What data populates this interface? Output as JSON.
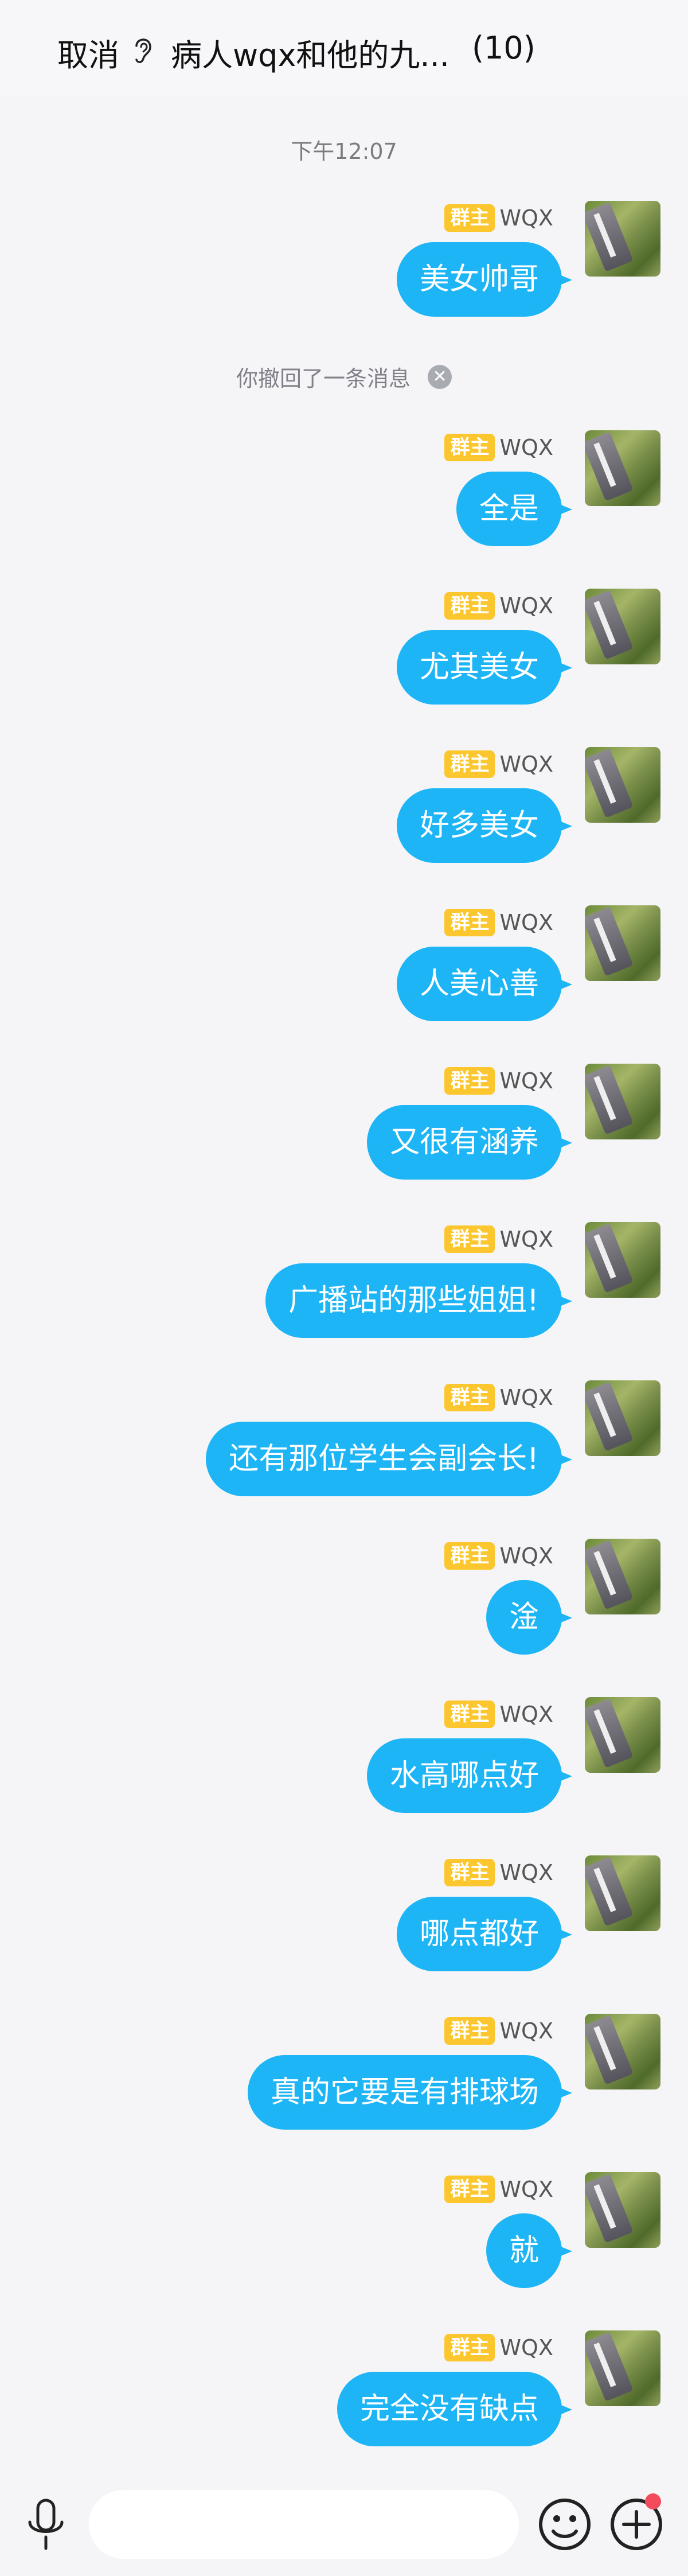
{
  "header": {
    "cancel_label": "取消",
    "group_title": "病人wqx和他的九...",
    "member_count": "(10)",
    "icon": "ear-icon"
  },
  "timestamp": "下午12:07",
  "recall_notice": "你撤回了一条消息",
  "sender": {
    "badge": "群主",
    "name": "WQX"
  },
  "messages": [
    {
      "text": "美女帅哥"
    },
    {
      "text": "全是"
    },
    {
      "text": "尤其美女"
    },
    {
      "text": "好多美女"
    },
    {
      "text": "人美心善"
    },
    {
      "text": "又很有涵养"
    },
    {
      "text": "广播站的那些姐姐!"
    },
    {
      "text": "还有那位学生会副会长!"
    },
    {
      "text": "淦"
    },
    {
      "text": "水高哪点好"
    },
    {
      "text": "哪点都好"
    },
    {
      "text": "真的它要是有排球场"
    },
    {
      "text": "就"
    },
    {
      "text": "完全没有缺点"
    }
  ],
  "colors": {
    "bubble": "#1db5f5",
    "badge": "#fcc72e",
    "notification_dot": "#f24b5c"
  },
  "bottom_icons": [
    "microphone-icon",
    "emoji-icon",
    "plus-icon"
  ]
}
